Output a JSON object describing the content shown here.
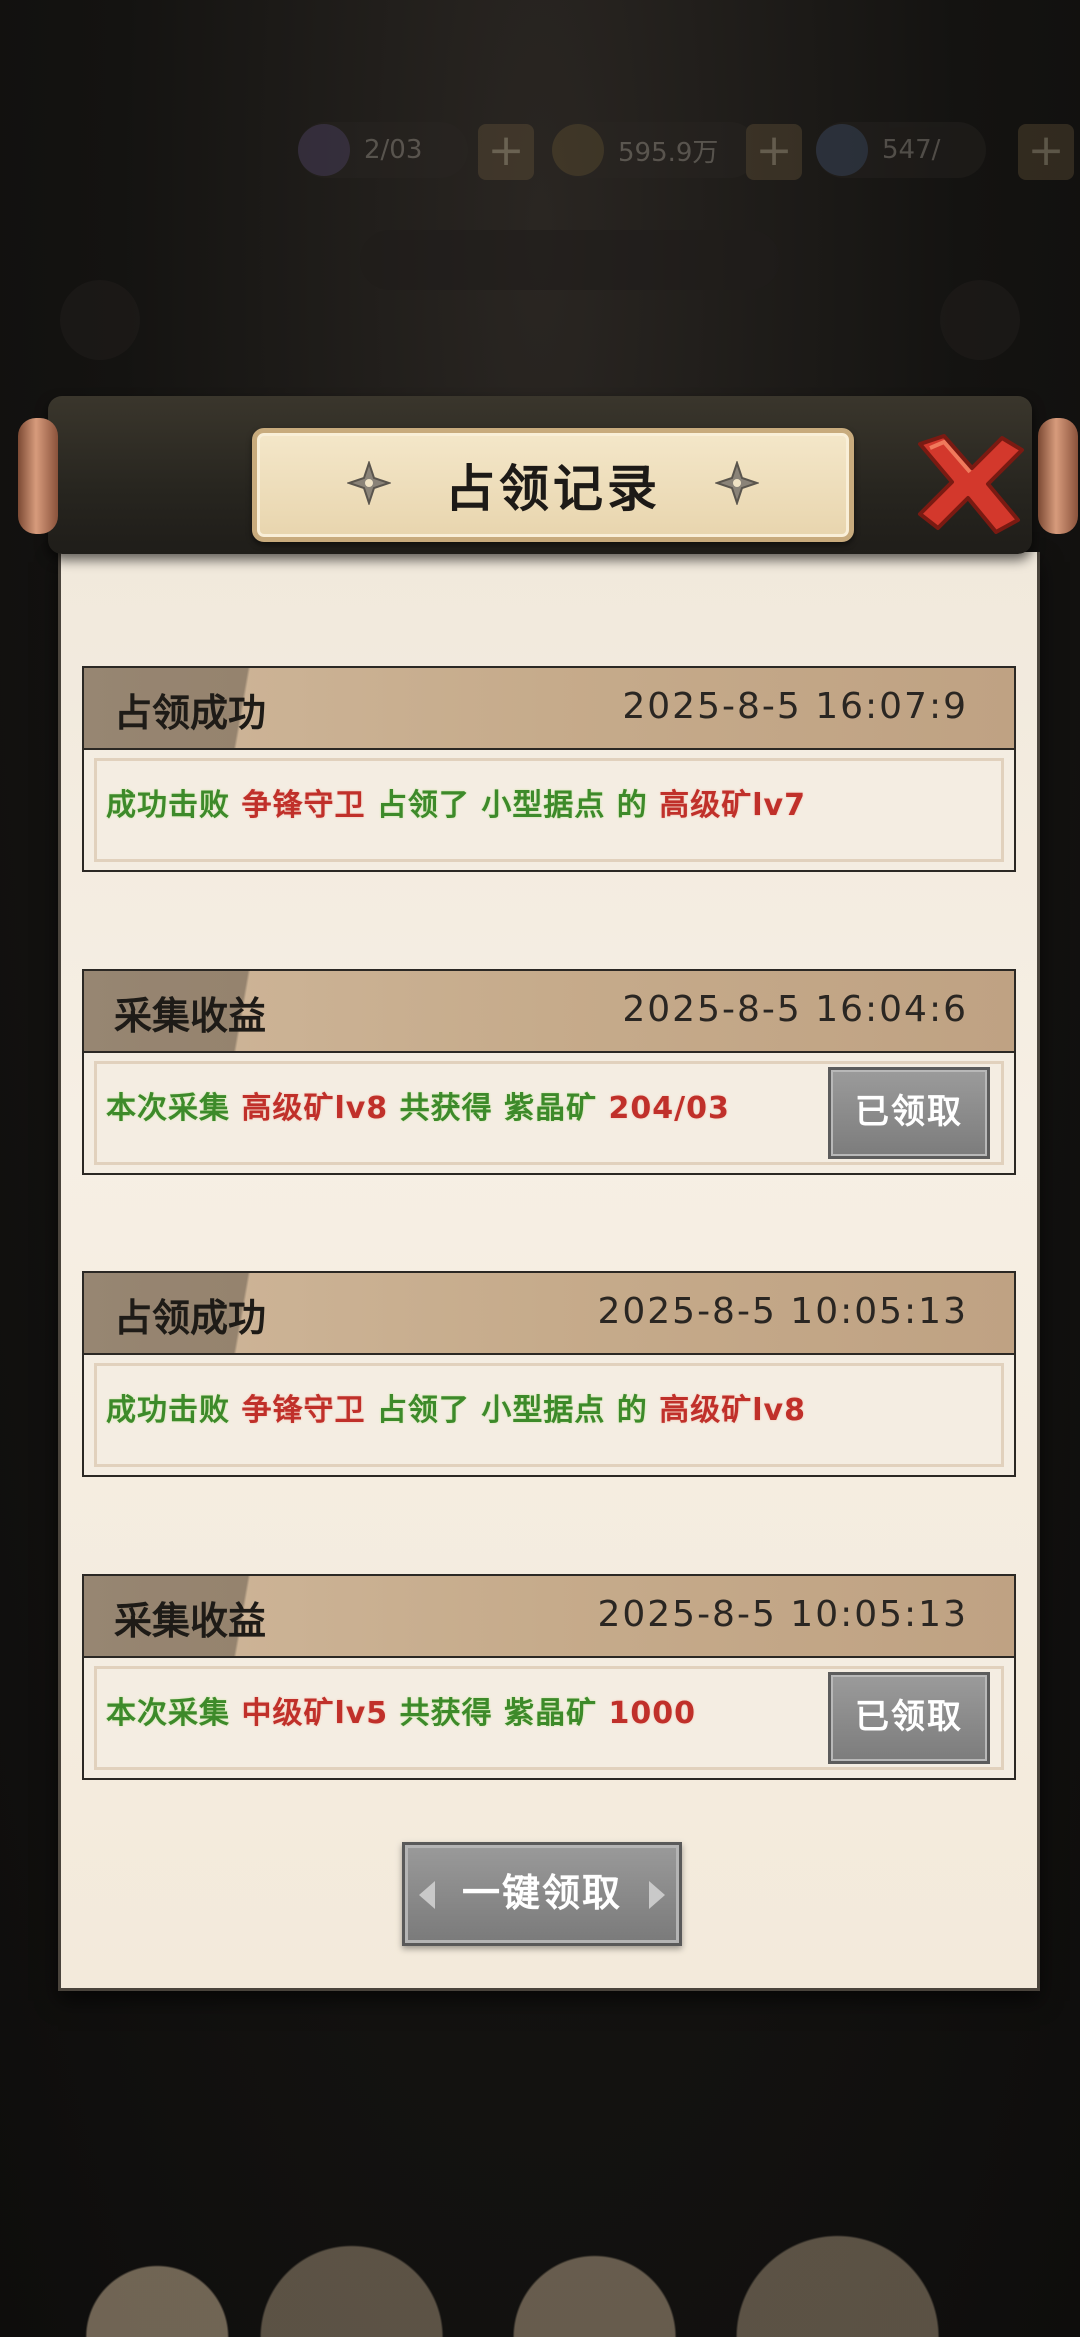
{
  "hud": {
    "resources": [
      {
        "icon": "crystal-icon",
        "value": "2/03"
      },
      {
        "icon": "coin-icon",
        "value": "595.9万"
      },
      {
        "icon": "gem-icon",
        "value": "547/"
      }
    ],
    "plus": "+"
  },
  "modal": {
    "title": "占领记录",
    "claim_all_label": "一键领取",
    "records": [
      {
        "type": "占领成功",
        "time": "2025-8-5  16:07:9",
        "segments": [
          {
            "text": "成功击败 ",
            "color": "green"
          },
          {
            "text": "争锋守卫 ",
            "color": "red"
          },
          {
            "text": "占领了 小型据点 的 ",
            "color": "green"
          },
          {
            "text": "高级矿lv7",
            "color": "red"
          }
        ]
      },
      {
        "type": "采集收益",
        "time": "2025-8-5  16:04:6",
        "segments": [
          {
            "text": "本次采集 ",
            "color": "green"
          },
          {
            "text": "高级矿lv8 ",
            "color": "red"
          },
          {
            "text": "共获得 紫晶矿 ",
            "color": "green"
          },
          {
            "text": "204/03",
            "color": "red"
          }
        ],
        "claimed_label": "已领取"
      },
      {
        "type": "占领成功",
        "time": "2025-8-5  10:05:13",
        "segments": [
          {
            "text": "成功击败 ",
            "color": "green"
          },
          {
            "text": "争锋守卫 ",
            "color": "red"
          },
          {
            "text": "占领了 小型据点 的 ",
            "color": "green"
          },
          {
            "text": "高级矿lv8",
            "color": "red"
          }
        ]
      },
      {
        "type": "采集收益",
        "time": "2025-8-5  10:05:13",
        "segments": [
          {
            "text": "本次采集 ",
            "color": "green"
          },
          {
            "text": "中级矿lv5 ",
            "color": "red"
          },
          {
            "text": "共获得 紫晶矿 ",
            "color": "green"
          },
          {
            "text": "1000",
            "color": "red"
          }
        ],
        "claimed_label": "已领取"
      }
    ]
  },
  "colors": {
    "green": "#3d8a2a",
    "red": "#c0302a",
    "paper": "#f4ede2"
  }
}
